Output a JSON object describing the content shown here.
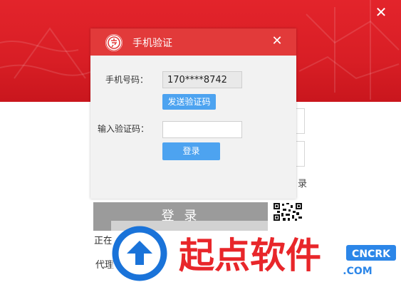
{
  "window": {
    "close_glyph": "✕"
  },
  "background": {
    "side_text": "录",
    "login_button": "登 录",
    "status_text": "正在",
    "proxy_text": "代理"
  },
  "dialog": {
    "title": "手机验证",
    "close_glyph": "✕",
    "phone_label": "手机号码：",
    "phone_value": "170****8742",
    "send_code_button": "发送验证码",
    "code_label": "输入验证码：",
    "code_value": "",
    "login_button": "登录"
  },
  "watermark": {
    "text": "起点软件",
    "badge_top": "CNCRK",
    "badge_bottom": ".COM"
  },
  "colors": {
    "banner_red": "#d81e25",
    "dialog_header": "#e23a3a",
    "button_blue": "#4da3f0",
    "watermark_blue": "#1a73d9",
    "watermark_red": "#e8262a"
  }
}
